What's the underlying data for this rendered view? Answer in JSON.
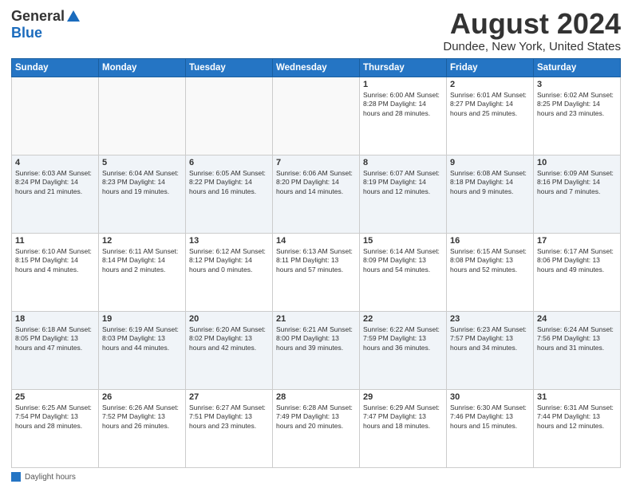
{
  "header": {
    "logo_general": "General",
    "logo_blue": "Blue",
    "title": "August 2024",
    "subtitle": "Dundee, New York, United States"
  },
  "days_of_week": [
    "Sunday",
    "Monday",
    "Tuesday",
    "Wednesday",
    "Thursday",
    "Friday",
    "Saturday"
  ],
  "footer": {
    "legend_label": "Daylight hours"
  },
  "weeks": [
    [
      {
        "day": "",
        "info": ""
      },
      {
        "day": "",
        "info": ""
      },
      {
        "day": "",
        "info": ""
      },
      {
        "day": "",
        "info": ""
      },
      {
        "day": "1",
        "info": "Sunrise: 6:00 AM\nSunset: 8:28 PM\nDaylight: 14 hours\nand 28 minutes."
      },
      {
        "day": "2",
        "info": "Sunrise: 6:01 AM\nSunset: 8:27 PM\nDaylight: 14 hours\nand 25 minutes."
      },
      {
        "day": "3",
        "info": "Sunrise: 6:02 AM\nSunset: 8:25 PM\nDaylight: 14 hours\nand 23 minutes."
      }
    ],
    [
      {
        "day": "4",
        "info": "Sunrise: 6:03 AM\nSunset: 8:24 PM\nDaylight: 14 hours\nand 21 minutes."
      },
      {
        "day": "5",
        "info": "Sunrise: 6:04 AM\nSunset: 8:23 PM\nDaylight: 14 hours\nand 19 minutes."
      },
      {
        "day": "6",
        "info": "Sunrise: 6:05 AM\nSunset: 8:22 PM\nDaylight: 14 hours\nand 16 minutes."
      },
      {
        "day": "7",
        "info": "Sunrise: 6:06 AM\nSunset: 8:20 PM\nDaylight: 14 hours\nand 14 minutes."
      },
      {
        "day": "8",
        "info": "Sunrise: 6:07 AM\nSunset: 8:19 PM\nDaylight: 14 hours\nand 12 minutes."
      },
      {
        "day": "9",
        "info": "Sunrise: 6:08 AM\nSunset: 8:18 PM\nDaylight: 14 hours\nand 9 minutes."
      },
      {
        "day": "10",
        "info": "Sunrise: 6:09 AM\nSunset: 8:16 PM\nDaylight: 14 hours\nand 7 minutes."
      }
    ],
    [
      {
        "day": "11",
        "info": "Sunrise: 6:10 AM\nSunset: 8:15 PM\nDaylight: 14 hours\nand 4 minutes."
      },
      {
        "day": "12",
        "info": "Sunrise: 6:11 AM\nSunset: 8:14 PM\nDaylight: 14 hours\nand 2 minutes."
      },
      {
        "day": "13",
        "info": "Sunrise: 6:12 AM\nSunset: 8:12 PM\nDaylight: 14 hours\nand 0 minutes."
      },
      {
        "day": "14",
        "info": "Sunrise: 6:13 AM\nSunset: 8:11 PM\nDaylight: 13 hours\nand 57 minutes."
      },
      {
        "day": "15",
        "info": "Sunrise: 6:14 AM\nSunset: 8:09 PM\nDaylight: 13 hours\nand 54 minutes."
      },
      {
        "day": "16",
        "info": "Sunrise: 6:15 AM\nSunset: 8:08 PM\nDaylight: 13 hours\nand 52 minutes."
      },
      {
        "day": "17",
        "info": "Sunrise: 6:17 AM\nSunset: 8:06 PM\nDaylight: 13 hours\nand 49 minutes."
      }
    ],
    [
      {
        "day": "18",
        "info": "Sunrise: 6:18 AM\nSunset: 8:05 PM\nDaylight: 13 hours\nand 47 minutes."
      },
      {
        "day": "19",
        "info": "Sunrise: 6:19 AM\nSunset: 8:03 PM\nDaylight: 13 hours\nand 44 minutes."
      },
      {
        "day": "20",
        "info": "Sunrise: 6:20 AM\nSunset: 8:02 PM\nDaylight: 13 hours\nand 42 minutes."
      },
      {
        "day": "21",
        "info": "Sunrise: 6:21 AM\nSunset: 8:00 PM\nDaylight: 13 hours\nand 39 minutes."
      },
      {
        "day": "22",
        "info": "Sunrise: 6:22 AM\nSunset: 7:59 PM\nDaylight: 13 hours\nand 36 minutes."
      },
      {
        "day": "23",
        "info": "Sunrise: 6:23 AM\nSunset: 7:57 PM\nDaylight: 13 hours\nand 34 minutes."
      },
      {
        "day": "24",
        "info": "Sunrise: 6:24 AM\nSunset: 7:56 PM\nDaylight: 13 hours\nand 31 minutes."
      }
    ],
    [
      {
        "day": "25",
        "info": "Sunrise: 6:25 AM\nSunset: 7:54 PM\nDaylight: 13 hours\nand 28 minutes."
      },
      {
        "day": "26",
        "info": "Sunrise: 6:26 AM\nSunset: 7:52 PM\nDaylight: 13 hours\nand 26 minutes."
      },
      {
        "day": "27",
        "info": "Sunrise: 6:27 AM\nSunset: 7:51 PM\nDaylight: 13 hours\nand 23 minutes."
      },
      {
        "day": "28",
        "info": "Sunrise: 6:28 AM\nSunset: 7:49 PM\nDaylight: 13 hours\nand 20 minutes."
      },
      {
        "day": "29",
        "info": "Sunrise: 6:29 AM\nSunset: 7:47 PM\nDaylight: 13 hours\nand 18 minutes."
      },
      {
        "day": "30",
        "info": "Sunrise: 6:30 AM\nSunset: 7:46 PM\nDaylight: 13 hours\nand 15 minutes."
      },
      {
        "day": "31",
        "info": "Sunrise: 6:31 AM\nSunset: 7:44 PM\nDaylight: 13 hours\nand 12 minutes."
      }
    ]
  ]
}
